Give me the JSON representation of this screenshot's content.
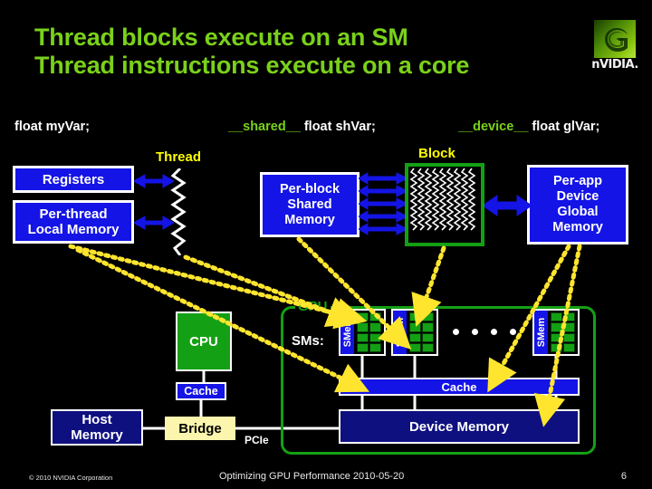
{
  "slide": {
    "title_line1": "Thread blocks execute on an SM",
    "title_line2": "Thread instructions execute on a core",
    "logo_word": "nVIDIA."
  },
  "code": {
    "thread_decl": "float  myVar;",
    "shared_keyword": "__shared__",
    "shared_decl": " float shVar;",
    "device_keyword": "__device__",
    "device_decl": " float glVar;"
  },
  "labels": {
    "thread": "Thread",
    "block": "Block",
    "gpu": "GPU",
    "sms": "SMs:",
    "pcie": "PCIe"
  },
  "memory_boxes": {
    "registers": "Registers",
    "local_memory": "Per-thread\nLocal Memory",
    "local_memory_l1": "Per-thread",
    "local_memory_l2": "Local Memory",
    "shared_memory_l1": "Per-block",
    "shared_memory_l2": "Shared",
    "shared_memory_l3": "Memory",
    "global_memory_l1": "Per-app",
    "global_memory_l2": "Device",
    "global_memory_l3": "Global",
    "global_memory_l4": "Memory"
  },
  "hardware": {
    "cpu": "CPU",
    "cpu_cache": "Cache",
    "host_memory_l1": "Host",
    "host_memory_l2": "Memory",
    "bridge": "Bridge",
    "gpu_cache": "Cache",
    "device_memory": "Device Memory",
    "smem_label": "SMem",
    "sm_count_visible": 3,
    "cores_per_sm": 8,
    "ellipsis_dots": 4
  },
  "footer": {
    "copyright": "© 2010 NVIDIA Corporation",
    "center": "Optimizing GPU Performance    2010-05-20",
    "page": "6"
  },
  "colors": {
    "background": "#000000",
    "title_green": "#7ad11a",
    "accent_green": "#14a014",
    "memory_blue": "#1414e6",
    "dark_blue": "#0f1080",
    "label_yellow": "#ffff00",
    "bridge_yellow": "#fbf5ae",
    "white": "#ffffff"
  }
}
